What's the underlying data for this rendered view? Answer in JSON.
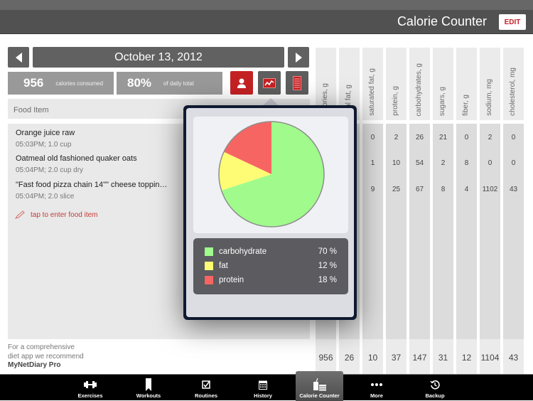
{
  "header": {
    "title": "Calorie Counter",
    "edit_label": "EDIT"
  },
  "date_nav": {
    "date": "October 13, 2012"
  },
  "stats": {
    "calories_value": "956",
    "calories_label": "calories consumed",
    "percent_value": "80%",
    "percent_label": "of daily total"
  },
  "view_buttons": [
    {
      "icon": "person-icon",
      "active": true
    },
    {
      "icon": "chart-icon",
      "active": false
    },
    {
      "icon": "list-icon",
      "active": false
    }
  ],
  "food": {
    "header": "Food Item",
    "items": [
      {
        "name": "Orange juice raw",
        "detail": "05:03PM; 1.0 cup"
      },
      {
        "name": "Oatmeal old fashioned quaker oats",
        "detail": "05:04PM; 2.0 cup dry"
      },
      {
        "name": "\"Fast food pizza chain 14\"\" cheese toppin…",
        "detail": "05:04PM; 2.0 slice"
      }
    ],
    "add_label": "tap to enter food item"
  },
  "nutrients": {
    "columns": [
      {
        "label": "calories, g",
        "values": [
          "",
          "",
          ""
        ],
        "total": "956"
      },
      {
        "label": "total fat, g",
        "values": [
          "",
          "",
          ""
        ],
        "total": "26"
      },
      {
        "label": "saturated fat, g",
        "values": [
          "0",
          "1",
          "9"
        ],
        "total": "10"
      },
      {
        "label": "protein, g",
        "values": [
          "2",
          "10",
          "25"
        ],
        "total": "37"
      },
      {
        "label": "carbohydrates, g",
        "values": [
          "26",
          "54",
          "67"
        ],
        "total": "147"
      },
      {
        "label": "sugars, g",
        "values": [
          "21",
          "2",
          "8"
        ],
        "total": "31"
      },
      {
        "label": "fiber, g",
        "values": [
          "0",
          "8",
          "4"
        ],
        "total": "12"
      },
      {
        "label": "sodium, mg",
        "values": [
          "2",
          "0",
          "1102"
        ],
        "total": "1104"
      },
      {
        "label": "cholesterol, mg",
        "values": [
          "0",
          "0",
          "43"
        ],
        "total": "43"
      }
    ]
  },
  "promo": {
    "line1": "For a comprehensive",
    "line2": "diet app we recommend",
    "app": "MyNetDiary Pro"
  },
  "chart_data": {
    "type": "pie",
    "title": "",
    "slices": [
      {
        "label": "carbohydrate",
        "value": 70,
        "display": "70 %",
        "color": "#a0fb8c"
      },
      {
        "label": "fat",
        "value": 12,
        "display": "12 %",
        "color": "#fefc74"
      },
      {
        "label": "protein",
        "value": 18,
        "display": "18 %",
        "color": "#f76562"
      }
    ],
    "legend_position": "bottom"
  },
  "tabs": [
    {
      "label": "Exercises",
      "icon": "dumbbell-icon"
    },
    {
      "label": "Workouts",
      "icon": "bookmark-icon"
    },
    {
      "label": "Routines",
      "icon": "checkbox-icon"
    },
    {
      "label": "History",
      "icon": "calendar-icon"
    },
    {
      "label": "Calorie Counter",
      "icon": "food-icon",
      "active": true
    },
    {
      "label": "More",
      "icon": "more-icon"
    },
    {
      "label": "Backup",
      "icon": "history-icon"
    }
  ]
}
